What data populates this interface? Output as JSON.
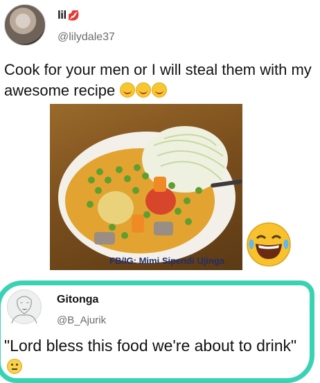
{
  "tweet": {
    "display_name": "lil",
    "display_name_emoji": "lips-icon",
    "handle": "@lilydale37",
    "text": "Cook for your men or I will steal them with my awesome recipe",
    "text_emojis": [
      "savoring-face-icon",
      "savoring-face-icon",
      "savoring-face-icon"
    ]
  },
  "photo": {
    "credit": "FB/IG: Mimi Sipendi Ujinga"
  },
  "reaction_emoji": "face-with-tears-of-joy-icon",
  "reply": {
    "display_name": "Gitonga",
    "handle": "@B_Ajurik",
    "text": "\"Lord bless this food we're about to drink\"",
    "text_emoji": "flushed-face-icon"
  },
  "colors": {
    "highlight_ring": "#39d3b4",
    "handle_gray": "#6b6b6b",
    "credit_blue": "#1f2d6b"
  }
}
